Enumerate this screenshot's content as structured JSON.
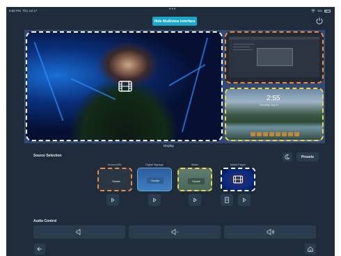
{
  "status_bar": {
    "time": "6:50 PM",
    "date": "Thu Jul 17",
    "battery": "5%",
    "more_dots": "•••"
  },
  "header": {
    "toggle_label": "Hide Multiview Interface",
    "power_icon": "power-icon"
  },
  "display": {
    "label": "Display",
    "zones": [
      {
        "name": "main",
        "border_color": "#ffffff",
        "content_icon": "film-icon"
      },
      {
        "name": "orange",
        "border_color": "#f08a3c"
      },
      {
        "name": "yellow",
        "border_color": "#f2d444"
      }
    ],
    "lockscreen_time": "2:55",
    "lockscreen_date": "Thursday, July 17"
  },
  "source_selection": {
    "title": "Source Selection",
    "presets_label": "Presets",
    "moon_icon": "moon-icon",
    "sources": [
      {
        "label": "Screen/URL",
        "tag": "Source",
        "accent": "#f08a3c"
      },
      {
        "label": "Digital Signage",
        "tag": "Source",
        "accent": "#69a7d8"
      },
      {
        "label": "Slides",
        "tag": "Source",
        "accent": "#f2d444"
      },
      {
        "label": "Media Player",
        "tag": "",
        "accent": "#ffffff"
      }
    ]
  },
  "audio": {
    "title": "Audio Control",
    "buttons": [
      "volume-mute-icon",
      "volume-low-icon",
      "volume-high-icon"
    ]
  },
  "nav": {
    "back_icon": "back-arrow-icon",
    "home_icon": "home-icon"
  },
  "colors": {
    "background": "#1f2c3b",
    "accent": "#1aa7c8",
    "orange": "#f08a3c",
    "yellow": "#f2d444"
  }
}
